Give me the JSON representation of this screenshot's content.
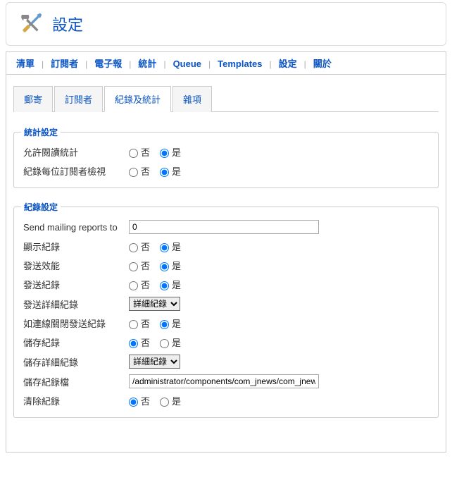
{
  "header": {
    "title": "設定"
  },
  "menu": {
    "items": [
      "清單",
      "訂閱者",
      "電子報",
      "統計",
      "Queue",
      "Templates",
      "設定",
      "關於"
    ],
    "activeIndex": 6
  },
  "tabs": {
    "items": [
      "郵寄",
      "訂閱者",
      "紀錄及統計",
      "雜項"
    ],
    "activeIndex": 2
  },
  "radio": {
    "no": "否",
    "yes": "是"
  },
  "group1": {
    "legend": "統計設定",
    "rows": [
      {
        "label": "允許閱讀統計",
        "value": "yes"
      },
      {
        "label": "紀錄每位訂閱者檢視",
        "value": "yes"
      }
    ]
  },
  "group2": {
    "legend": "紀錄設定",
    "sendRow": {
      "label": "Send mailing reports to",
      "value": "0"
    },
    "radioRows1": [
      {
        "label": "顯示紀錄",
        "value": "yes"
      },
      {
        "label": "發送效能",
        "value": "yes"
      },
      {
        "label": "發送紀錄",
        "value": "yes"
      }
    ],
    "detail1": {
      "label": "發送詳細紀錄",
      "options": [
        "詳細紀錄"
      ],
      "selected": "詳細紀錄"
    },
    "radioRows2": [
      {
        "label": "如連線關閉發送紀錄",
        "value": "yes"
      },
      {
        "label": "儲存紀錄",
        "value": "no"
      }
    ],
    "detail2": {
      "label": "儲存詳細紀錄",
      "options": [
        "詳細紀錄"
      ],
      "selected": "詳細紀錄"
    },
    "fileRow": {
      "label": "儲存紀錄檔",
      "value": "/administrator/components/com_jnews/com_jnews"
    },
    "clearRow": {
      "label": "清除紀錄",
      "value": "no"
    }
  }
}
